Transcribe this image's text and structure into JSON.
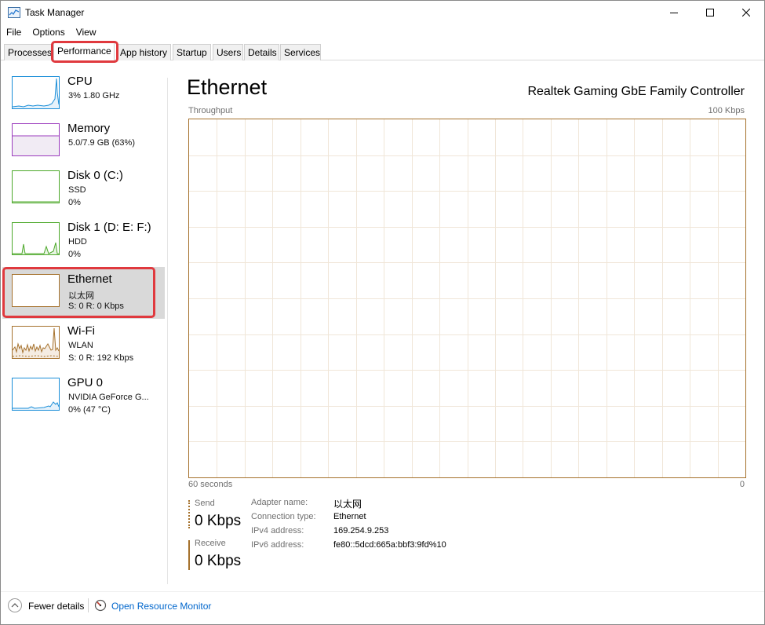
{
  "window": {
    "title": "Task Manager"
  },
  "menu": [
    "File",
    "Options",
    "View"
  ],
  "tabs": [
    "Processes",
    "Performance",
    "App history",
    "Startup",
    "Users",
    "Details",
    "Services"
  ],
  "active_tab": "Performance",
  "sidebar": [
    {
      "name": "CPU",
      "sub1": "3%  1.80 GHz",
      "sub2": "",
      "color": "#1a8ed8"
    },
    {
      "name": "Memory",
      "sub1": "5.0/7.9 GB (63%)",
      "sub2": "",
      "color": "#9b3bbd"
    },
    {
      "name": "Disk 0 (C:)",
      "sub1": "SSD",
      "sub2": "0%",
      "color": "#4ca82a"
    },
    {
      "name": "Disk 1 (D: E: F:)",
      "sub1": "HDD",
      "sub2": "0%",
      "color": "#4ca82a"
    },
    {
      "name": "Ethernet",
      "sub1": "以太网",
      "sub2": "S: 0  R: 0 Kbps",
      "color": "#a5712c",
      "selected": true
    },
    {
      "name": "Wi-Fi",
      "sub1": "WLAN",
      "sub2": "S: 0  R: 192 Kbps",
      "color": "#a5712c"
    },
    {
      "name": "GPU 0",
      "sub1": "NVIDIA GeForce G...",
      "sub2": "0% (47 °C)",
      "color": "#1a8ed8"
    }
  ],
  "main": {
    "title": "Ethernet",
    "adapter": "Realtek Gaming GbE Family Controller",
    "graph_label": "Throughput",
    "graph_max": "100 Kbps",
    "graph_time": "60 seconds",
    "graph_min": "0",
    "send_label": "Send",
    "send_value": "0 Kbps",
    "receive_label": "Receive",
    "receive_value": "0 Kbps",
    "details": [
      {
        "key": "Adapter name:",
        "value": "以太网"
      },
      {
        "key": "Connection type:",
        "value": "Ethernet"
      },
      {
        "key": "IPv4 address:",
        "value": "169.254.9.253"
      },
      {
        "key": "IPv6 address:",
        "value": "fe80::5dcd:665a:bbf3:9fd%10"
      }
    ]
  },
  "footer": {
    "fewer_details": "Fewer details",
    "open_monitor": "Open Resource Monitor"
  }
}
